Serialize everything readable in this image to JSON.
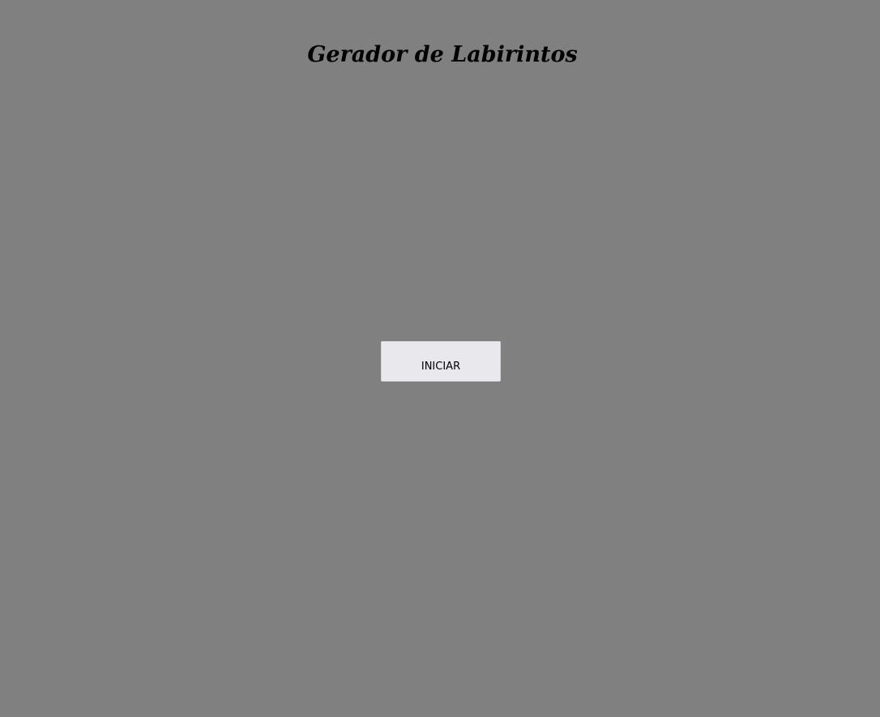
{
  "app": {
    "title": "Gerador de Labirintos",
    "background_color": "#808080"
  },
  "start_button": {
    "label": "INICIAR",
    "background_color": "#e9e8ed"
  }
}
